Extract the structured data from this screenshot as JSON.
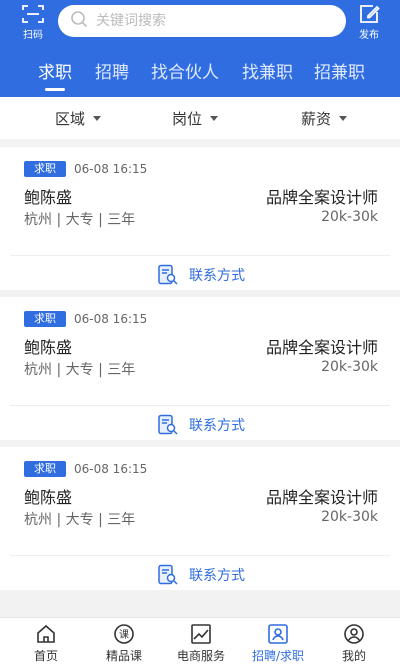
{
  "header": {
    "scan_label": "扫码",
    "publish_label": "发布",
    "search": {
      "placeholder": "关键词搜索",
      "value": ""
    },
    "tabs": [
      {
        "label": "求职",
        "active": true
      },
      {
        "label": "招聘",
        "active": false
      },
      {
        "label": "找合伙人",
        "active": false
      },
      {
        "label": "找兼职",
        "active": false
      },
      {
        "label": "招兼职",
        "active": false
      }
    ]
  },
  "filters": [
    {
      "label": "区域"
    },
    {
      "label": "岗位"
    },
    {
      "label": "薪资"
    }
  ],
  "cards": [
    {
      "badge": "求职",
      "time": "06-08  16:15",
      "name": "鲍陈盛",
      "meta": "杭州 | 大专 | 三年",
      "job": "品牌全案设计师",
      "salary": "20k-30k",
      "contact": "联系方式"
    },
    {
      "badge": "求职",
      "time": "06-08  16:15",
      "name": "鲍陈盛",
      "meta": "杭州 | 大专 | 三年",
      "job": "品牌全案设计师",
      "salary": "20k-30k",
      "contact": "联系方式"
    },
    {
      "badge": "求职",
      "time": "06-08  16:15",
      "name": "鲍陈盛",
      "meta": "杭州 | 大专 | 三年",
      "job": "品牌全案设计师",
      "salary": "20k-30k",
      "contact": "联系方式"
    }
  ],
  "bottom_nav": [
    {
      "label": "首页",
      "icon": "home-icon",
      "active": false
    },
    {
      "label": "精品课",
      "icon": "course-icon",
      "active": false
    },
    {
      "label": "电商服务",
      "icon": "chart-icon",
      "active": false
    },
    {
      "label": "招聘/求职",
      "icon": "recruit-icon",
      "active": true
    },
    {
      "label": "我的",
      "icon": "profile-icon",
      "active": false
    }
  ],
  "colors": {
    "primary": "#2f6de0",
    "background": "#f2f2f2",
    "text": "#222222",
    "muted": "#666666"
  }
}
